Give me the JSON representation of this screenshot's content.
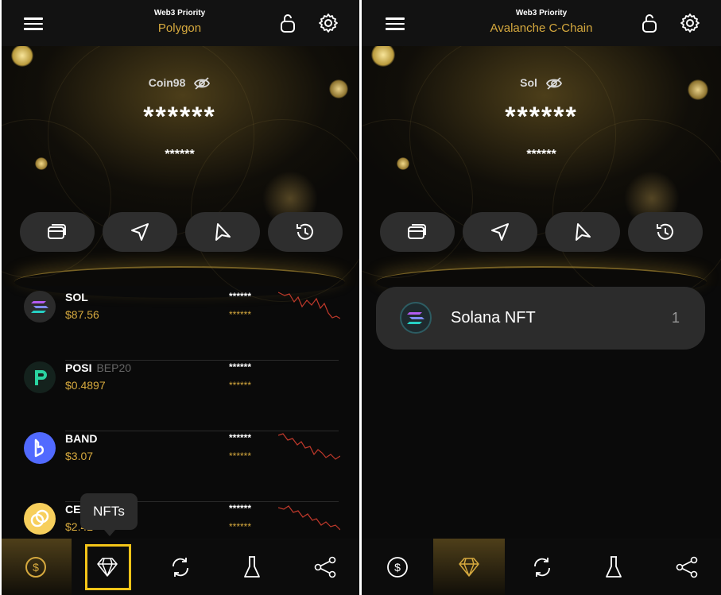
{
  "colors": {
    "accent": "#d6a93e",
    "chart_line": "#c0392b",
    "highlight": "#f3c418"
  },
  "left": {
    "header": {
      "priority_label": "Web3 Priority",
      "network": "Polygon"
    },
    "wallet": {
      "name": "Coin98",
      "balance": "******",
      "sub_balance": "******"
    },
    "tokens": [
      {
        "symbol": "SOL",
        "network": "",
        "price": "$87.56",
        "amount": "******",
        "value": "******"
      },
      {
        "symbol": "POSI",
        "network": "BEP20",
        "price": "$0.4897",
        "amount": "******",
        "value": "******"
      },
      {
        "symbol": "BAND",
        "network": "",
        "price": "$3.07",
        "amount": "******",
        "value": "******"
      },
      {
        "symbol": "CE",
        "network": "",
        "price": "$2.42",
        "amount": "******",
        "value": "******"
      }
    ],
    "tooltip": "NFTs"
  },
  "right": {
    "header": {
      "priority_label": "Web3 Priority",
      "network": "Avalanche C-Chain"
    },
    "wallet": {
      "name": "Sol",
      "balance": "******",
      "sub_balance": "******"
    },
    "nft": {
      "name": "Solana NFT",
      "count": "1"
    }
  },
  "icons": {
    "actions": [
      "cards-icon",
      "send-icon",
      "receive-icon",
      "history-icon"
    ],
    "nav": [
      "dollar-icon",
      "diamond-icon",
      "swap-icon",
      "flask-icon",
      "share-icon"
    ]
  }
}
